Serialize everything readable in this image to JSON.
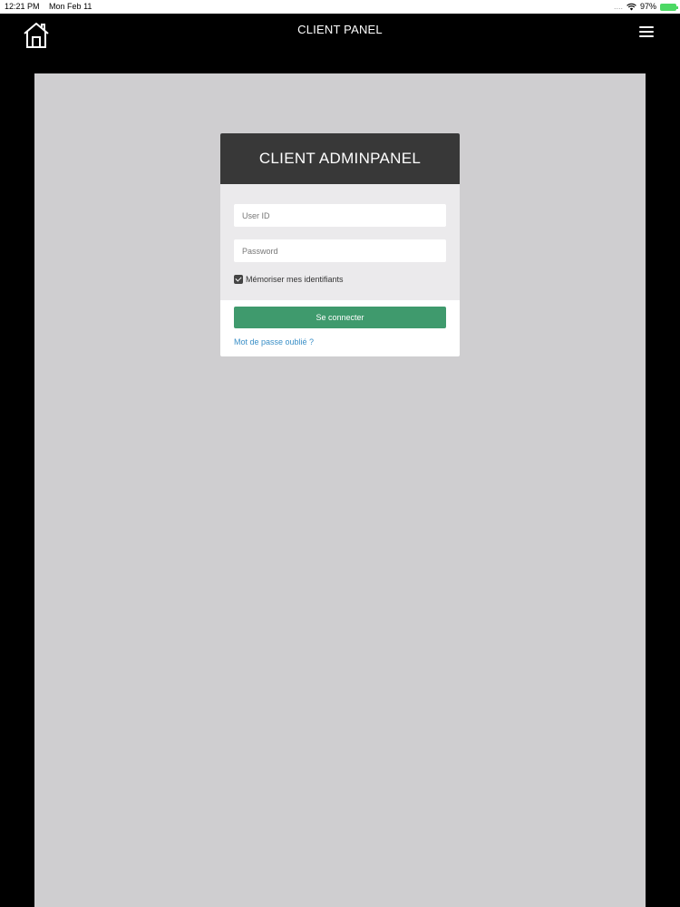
{
  "status_bar": {
    "time": "12:21 PM",
    "date": "Mon Feb 11",
    "signal": "....",
    "battery_percent": "97%"
  },
  "nav": {
    "title": "CLIENT PANEL",
    "home_icon": "home-icon",
    "menu_icon": "hamburger-menu-icon"
  },
  "login": {
    "title": "CLIENT ADMINPANEL",
    "user_placeholder": "User ID",
    "password_placeholder": "Password",
    "remember_label": "Mémoriser mes identifiants",
    "remember_checked": true,
    "submit_label": "Se connecter",
    "forgot_label": "Mot de passe oublié ?"
  },
  "colors": {
    "header_bg": "#383838",
    "button_bg": "#3f9a6d",
    "link": "#3a8fc7",
    "panel_bg": "#cfced0"
  }
}
